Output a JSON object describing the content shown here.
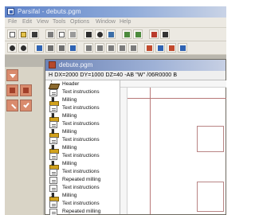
{
  "app": {
    "title": "Parsifal - debuts.pgm"
  },
  "menu": {
    "items": [
      "File",
      "Edit",
      "View",
      "Tools",
      "Options",
      "Window",
      "Help"
    ]
  },
  "toolbar1": {
    "icons": [
      "new-file-icon",
      "open-folder-icon",
      "save-icon",
      "cut-icon",
      "copy-icon",
      "paste-icon",
      "print-icon",
      "settings-icon",
      "stop-icon",
      "tool-icon",
      "tool-icon",
      "info-icon",
      "help-icon"
    ]
  },
  "toolbar2": {
    "icons": [
      "zoom-in-icon",
      "zoom-out-icon",
      "tool-icon",
      "tool-icon",
      "tool-icon",
      "tool-icon",
      "tool-icon",
      "tool-icon",
      "tool-icon",
      "tool-icon",
      "tool-icon",
      "tool-icon",
      "tool-icon",
      "tool-icon",
      "tool-icon"
    ]
  },
  "child_window": {
    "title": "debute.pgm",
    "nc_header": "H DX=2000 DY=1000 DZ=40 -AB \"W\" /06R0000 B"
  },
  "tree": {
    "items": [
      {
        "label": "Header",
        "icon": "header-icon"
      },
      {
        "label": "Text instructions",
        "icon": "document-icon"
      },
      {
        "label": "Milling",
        "icon": "milling-icon"
      },
      {
        "label": "Text instructions",
        "icon": "document-icon"
      },
      {
        "label": "Milling",
        "icon": "milling-icon"
      },
      {
        "label": "Text instructions",
        "icon": "document-icon"
      },
      {
        "label": "Milling",
        "icon": "milling-icon"
      },
      {
        "label": "Text instructions",
        "icon": "document-icon"
      },
      {
        "label": "Milling",
        "icon": "milling-icon"
      },
      {
        "label": "Text instructions",
        "icon": "document-icon"
      },
      {
        "label": "Milling",
        "icon": "milling-icon"
      },
      {
        "label": "Text instructions",
        "icon": "document-icon"
      },
      {
        "label": "Repeated milling",
        "icon": "document-icon"
      },
      {
        "label": "Text instructions",
        "icon": "document-icon"
      },
      {
        "label": "Milling",
        "icon": "milling-icon"
      },
      {
        "label": "Text instructions",
        "icon": "document-icon"
      },
      {
        "label": "Repeated milling",
        "icon": "document-icon"
      }
    ]
  },
  "colors": {
    "title_bar": "#5f83c9",
    "dock_button": "#d98b6d",
    "canvas_line": "#b87878"
  }
}
